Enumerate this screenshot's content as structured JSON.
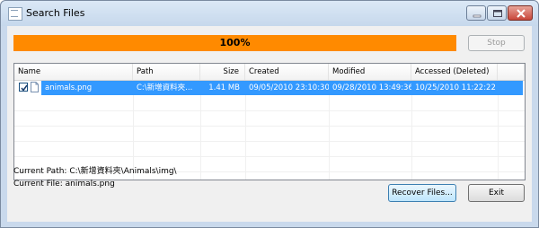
{
  "window": {
    "title": "Search Files"
  },
  "progress": {
    "label": "100%",
    "fraction": 1.0
  },
  "buttons": {
    "stop": "Stop",
    "recover": "Recover Files...",
    "exit": "Exit"
  },
  "table": {
    "columns": [
      "Name",
      "Path",
      "Size",
      "Created",
      "Modified",
      "Accessed (Deleted)"
    ],
    "rows": [
      {
        "checked": true,
        "name": "animals.png",
        "path": "C:\\新增資料夾...",
        "size": "1.41 MB",
        "created": "09/05/2010 23:10:30",
        "modified": "09/28/2010 13:49:36",
        "accessed": "10/25/2010 11:22:22"
      }
    ]
  },
  "status": {
    "current_path": "Current Path: C:\\新增資料夾\\Animals\\img\\",
    "current_file": "Current File: animals.png"
  },
  "icons": [
    "app-icon",
    "minimize-icon",
    "maximize-icon",
    "close-icon",
    "checkbox-checked-icon",
    "file-icon"
  ],
  "colors": {
    "progress": "#ff8a00",
    "selection": "#3399ff"
  }
}
